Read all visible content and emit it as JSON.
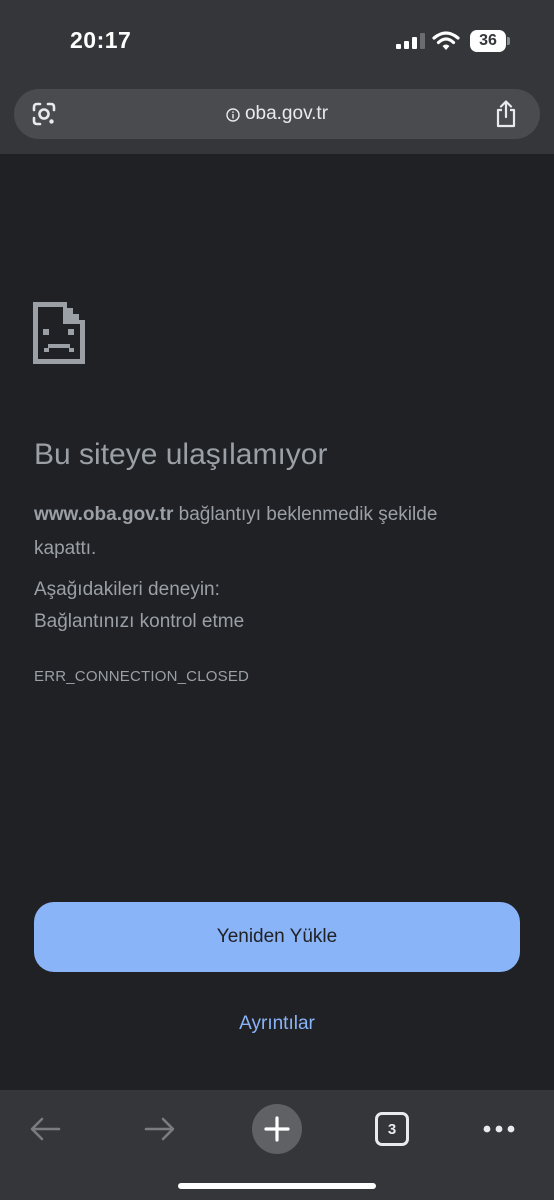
{
  "status_bar": {
    "time": "20:17",
    "battery": "36",
    "icons": [
      "signal-icon",
      "wifi-icon",
      "battery-icon"
    ]
  },
  "address_bar": {
    "url": "oba.gov.tr",
    "icons": [
      "lens-icon",
      "info-icon",
      "share-icon"
    ]
  },
  "error": {
    "icon": "sad-page-icon",
    "title": "Bu siteye ulaşılamıyor",
    "domain": "www.oba.gov.tr",
    "message": " bağlantıyı beklenmedik şekilde kapattı.",
    "try_label": "Aşağıdakileri deneyin:",
    "try_item": "Bağlantınızı kontrol etme",
    "code": "ERR_CONNECTION_CLOSED"
  },
  "actions": {
    "reload_label": "Yeniden Yükle",
    "details_label": "Ayrıntılar"
  },
  "toolbar": {
    "tab_count": "3",
    "icons": [
      "back-icon",
      "forward-icon",
      "new-tab-icon",
      "tab-switcher-icon",
      "more-icon"
    ]
  },
  "colors": {
    "background": "#202124",
    "chrome": "#35363a",
    "accent": "#8ab4f8",
    "text": "#9aa0a6"
  }
}
